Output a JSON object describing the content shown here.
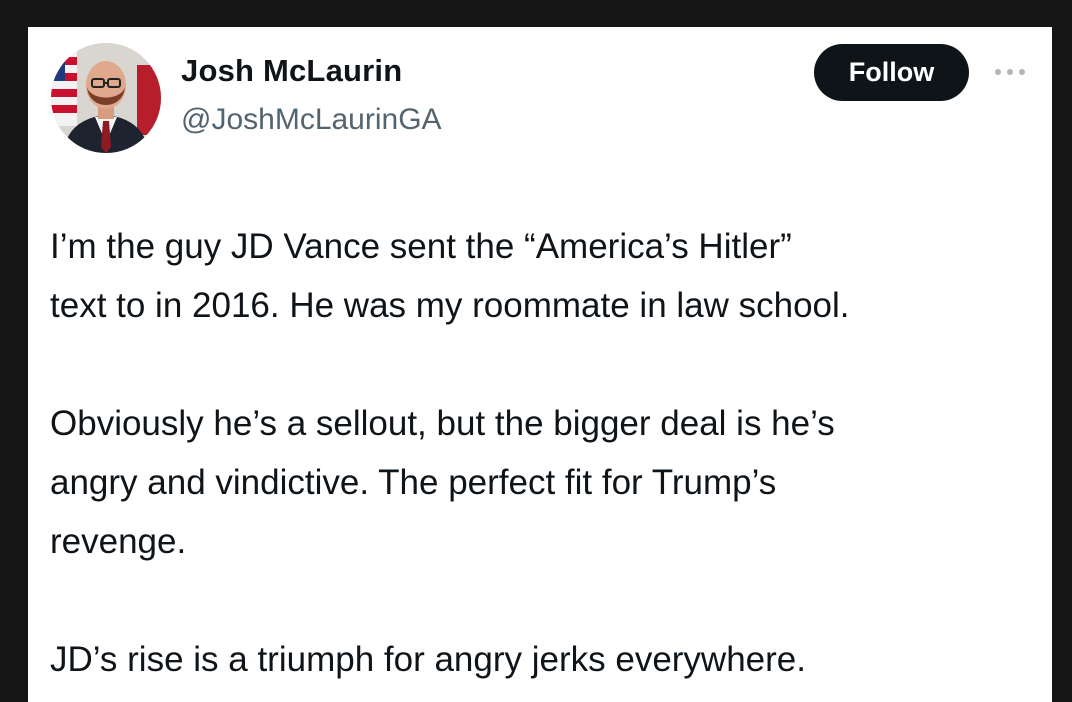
{
  "author": {
    "name": "Josh McLaurin",
    "handle": "@JoshMcLaurinGA",
    "avatar_icon": "profile-photo"
  },
  "actions": {
    "follow_label": "Follow",
    "more_icon": "more-horizontal-icon"
  },
  "tweet": {
    "paragraphs": [
      "I’m the guy JD Vance sent the “America’s Hitler”\ntext to in 2016. He was my roommate in law school.",
      "Obviously he’s a sellout, but the bigger deal is he’s\nangry and vindictive. The perfect fit for Trump’s\nrevenge.",
      "JD’s rise is a triumph for angry jerks everywhere."
    ]
  },
  "colors": {
    "background": "#161616",
    "card": "#ffffff",
    "text": "#0f1419",
    "secondary_text": "#536471",
    "button_bg": "#0f1419",
    "button_text": "#ffffff"
  }
}
